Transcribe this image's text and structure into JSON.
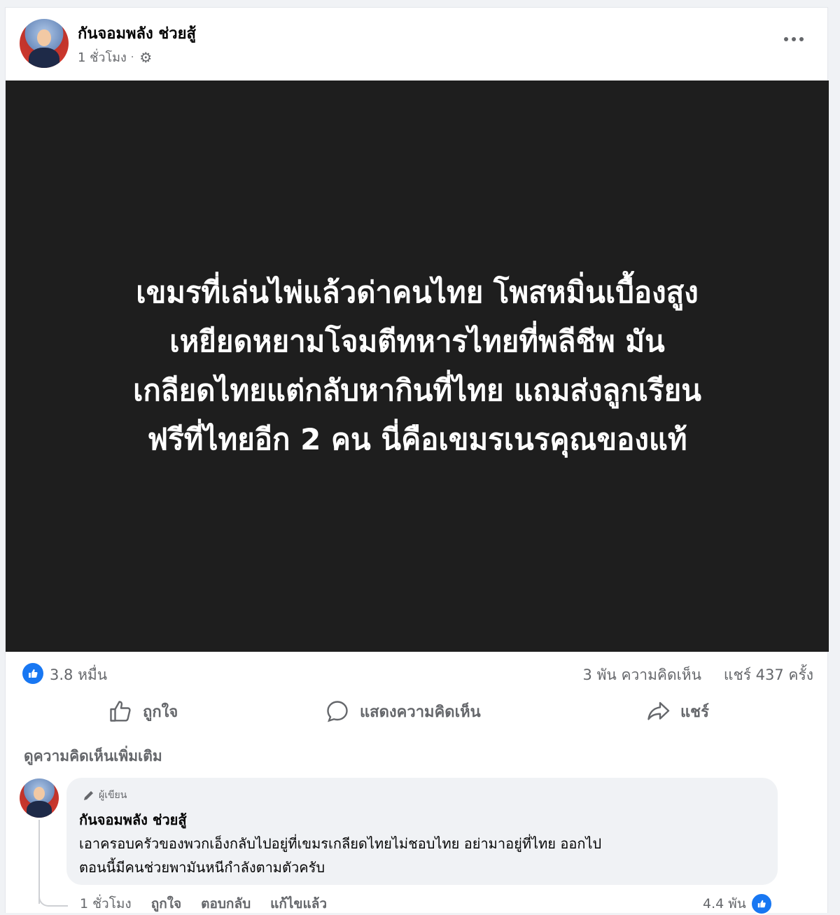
{
  "post": {
    "author": "กันจอมพลัง ช่วยสู้",
    "time": "1 ชั่วโมง",
    "separator": "·",
    "privacy_icon": "gear-icon",
    "image_text": [
      "เขมรที่เล่นไพ่แล้วด่าคนไทย โพสหมิ่นเบื้องสูง",
      "เหยียดหยามโจมตีทหารไทยที่พลีชีพ มัน",
      "เกลียดไทยแต่กลับหากินที่ไทย แถมส่งลูกเรียน",
      "ฟรีที่ไทยอีก 2 คน นี่คือเขมรเนรคุณของแท้"
    ]
  },
  "stats": {
    "reactions": "3.8 หมื่น",
    "comments": "3 พัน ความคิดเห็น",
    "shares": "แชร์ 437 ครั้ง"
  },
  "actions": {
    "like": "ถูกใจ",
    "comment": "แสดงความคิดเห็น",
    "share": "แชร์"
  },
  "view_more_comments": "ดูความคิดเห็นเพิ่มเติม",
  "comment": {
    "badge": "ผู้เขียน",
    "author": "กันจอมพลัง ช่วยสู้",
    "text_lines": [
      "เอาครอบครัวของพวกเอ็งกลับไปอยู่ที่เขมรเกลียดไทยไม่ชอบไทย อย่ามาอยู่ที่ไทย ออกไป",
      "ตอนนี้มีคนช่วยพามันหนีกำลังตามตัวครับ"
    ],
    "time": "1 ชั่วโมง",
    "like": "ถูกใจ",
    "reply": "ตอบกลับ",
    "edited": "แก้ไขแล้ว",
    "reactions": "4.4 พัน"
  },
  "colors": {
    "accent": "#1877f2",
    "image_bg": "#1e1e1e",
    "muted_text": "#65676b"
  }
}
